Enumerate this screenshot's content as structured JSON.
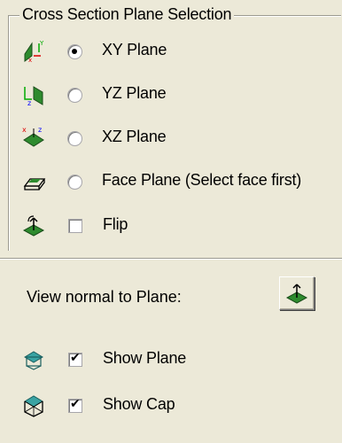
{
  "group": {
    "title": "Cross Section Plane Selection"
  },
  "planes": [
    {
      "label": "XY Plane",
      "selected": true
    },
    {
      "label": "YZ Plane",
      "selected": false
    },
    {
      "label": "XZ Plane",
      "selected": false
    },
    {
      "label": "Face Plane (Select face first)",
      "selected": false
    }
  ],
  "flip": {
    "label": "Flip",
    "checked": false
  },
  "view_normal": {
    "label": "View normal to Plane:"
  },
  "show_plane": {
    "label": "Show Plane",
    "checked": true
  },
  "show_cap": {
    "label": "Show Cap",
    "checked": true
  },
  "icons": {
    "xy": "xy-plane-icon",
    "yz": "yz-plane-icon",
    "xz": "xz-plane-icon",
    "face": "face-plane-icon",
    "flip": "flip-icon",
    "view_normal": "view-normal-icon",
    "show_plane": "show-plane-icon",
    "show_cap": "show-cap-icon"
  }
}
